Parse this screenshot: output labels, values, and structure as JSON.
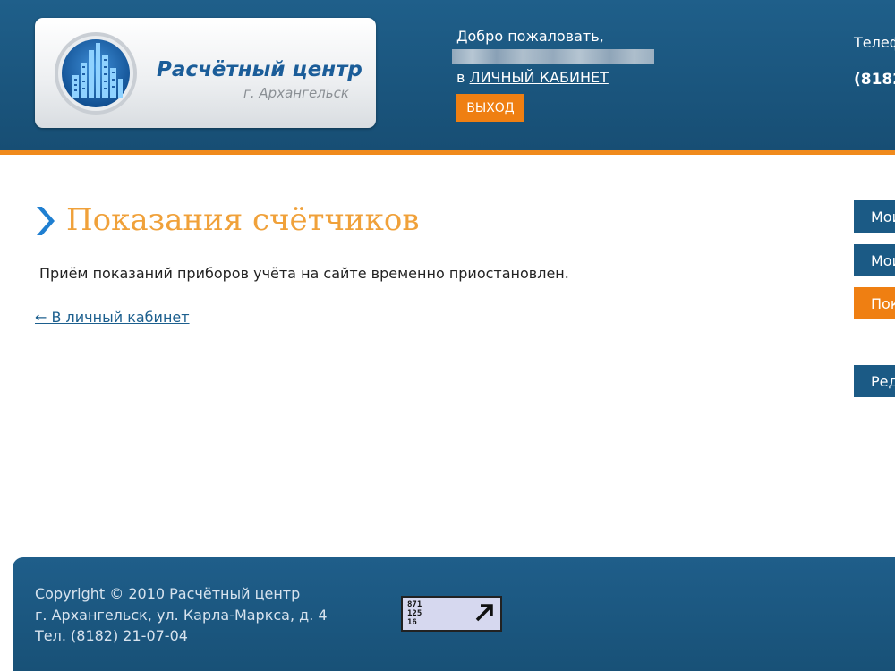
{
  "header": {
    "logo": {
      "title": "Расчётный центр",
      "subtitle": "г. Архангельск"
    },
    "welcome_text": "Добро пожаловать,",
    "cabinet_prefix": "в",
    "cabinet_link": "ЛИЧНЫЙ КАБИНЕТ",
    "logout_label": "ВЫХОД",
    "phone_label": "Телеф",
    "phone_number": "(8182"
  },
  "main": {
    "title": "Показания счётчиков",
    "notice": "Приём показаний приборов учёта на сайте временно приостановлен.",
    "back_link": "← В личный кабинет"
  },
  "sidebar": {
    "items": [
      {
        "label": "Мои",
        "state": "normal"
      },
      {
        "label": "Мои",
        "state": "normal"
      },
      {
        "label": "Пока",
        "state": "active"
      },
      {
        "label": "Ред",
        "state": "normal"
      }
    ]
  },
  "footer": {
    "copyright": "Copyright © 2010 Расчётный центр",
    "address": "г. Архангельск, ул. Карла-Маркса, д. 4",
    "phone": "Тел. (8182) 21-07-04",
    "counter_lines": [
      "871",
      "125",
      "16"
    ]
  },
  "colors": {
    "header_blue": "#1b5a85",
    "accent_orange": "#ef7f12",
    "title_orange": "#f0a13a",
    "link_blue": "#1c5f8e"
  },
  "icons": [
    "building-logo-icon",
    "chevron-right-icon",
    "arrow-up-right-icon"
  ]
}
